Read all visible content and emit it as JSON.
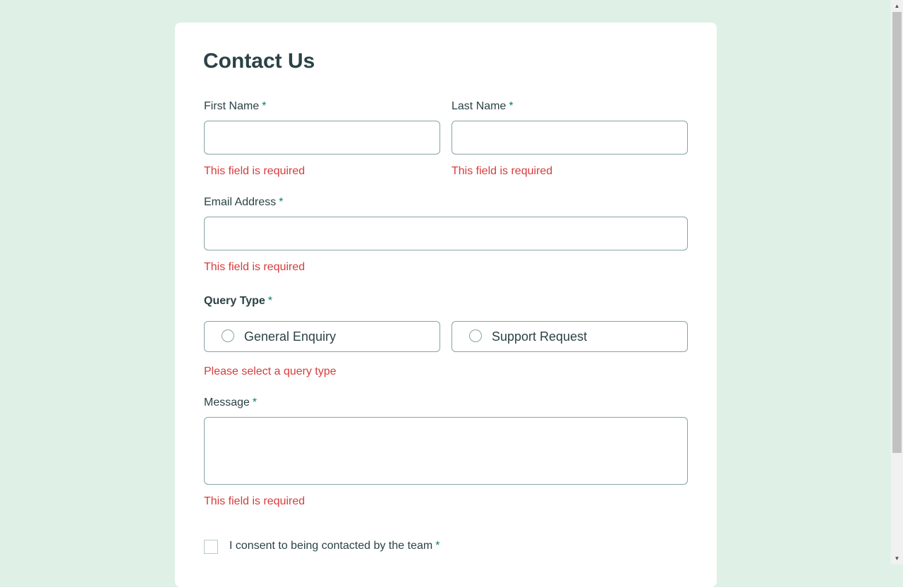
{
  "form": {
    "title": "Contact Us",
    "required_marker": "*",
    "first_name": {
      "label": "First Name",
      "value": "",
      "error": "This field is required"
    },
    "last_name": {
      "label": "Last Name",
      "value": "",
      "error": "This field is required"
    },
    "email": {
      "label": "Email Address",
      "value": "",
      "error": "This field is required"
    },
    "query_type": {
      "label": "Query Type",
      "options": [
        "General Enquiry",
        "Support Request"
      ],
      "selected": null,
      "error": "Please select a query type"
    },
    "message": {
      "label": "Message",
      "value": "",
      "error": "This field is required"
    },
    "consent": {
      "label": "I consent to being contacted by the team",
      "checked": false
    }
  },
  "colors": {
    "background": "#dff1e7",
    "card": "#ffffff",
    "text": "#2b4246",
    "accent": "#0c7d69",
    "error": "#d73c3c",
    "border": "#87a3a6"
  }
}
